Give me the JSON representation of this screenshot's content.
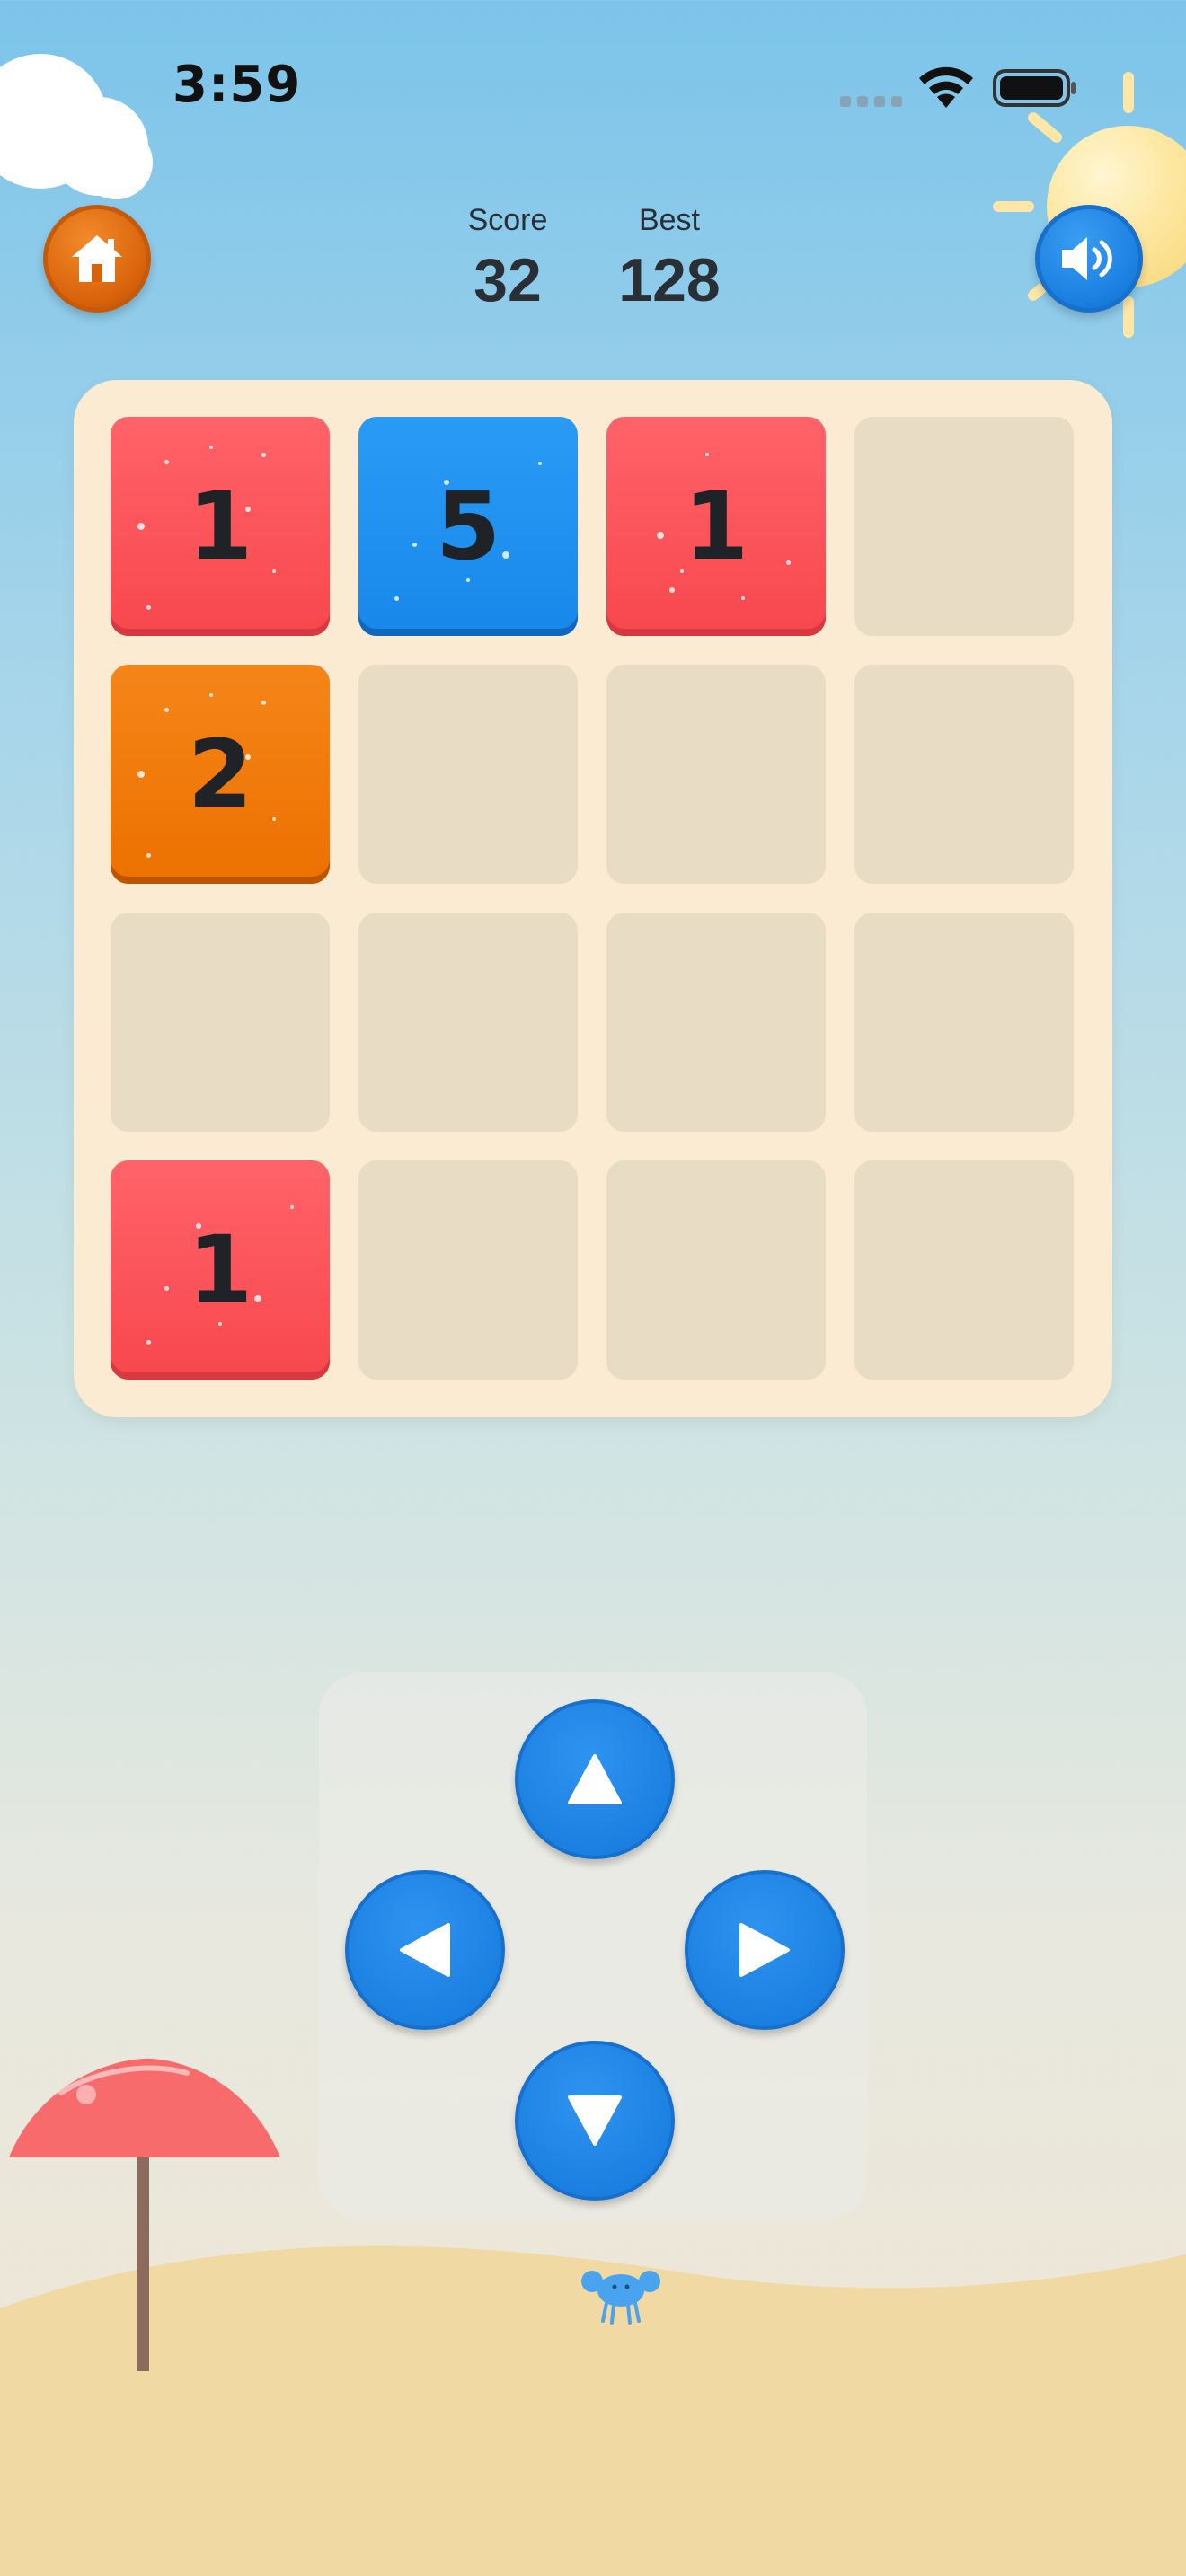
{
  "status_bar": {
    "time": "3:59"
  },
  "scores": {
    "score_label": "Score",
    "score_value": "32",
    "best_label": "Best",
    "best_value": "128"
  },
  "board": {
    "rows": 4,
    "cols": 4,
    "tiles": [
      {
        "row": 0,
        "col": 0,
        "value": "1",
        "color": "red"
      },
      {
        "row": 0,
        "col": 1,
        "value": "5",
        "color": "blue"
      },
      {
        "row": 0,
        "col": 2,
        "value": "1",
        "color": "red"
      },
      {
        "row": 1,
        "col": 0,
        "value": "2",
        "color": "orange"
      },
      {
        "row": 3,
        "col": 0,
        "value": "1",
        "color": "red"
      }
    ]
  },
  "controls": {
    "home": "home-icon",
    "sound": "speaker-icon",
    "arrows": [
      "up",
      "left",
      "right",
      "down"
    ]
  },
  "colors": {
    "red": "#f7474d",
    "blue": "#1788ea",
    "orange": "#ec7100",
    "board": "#faebd2",
    "empty_cell": "#e8dcc4"
  }
}
